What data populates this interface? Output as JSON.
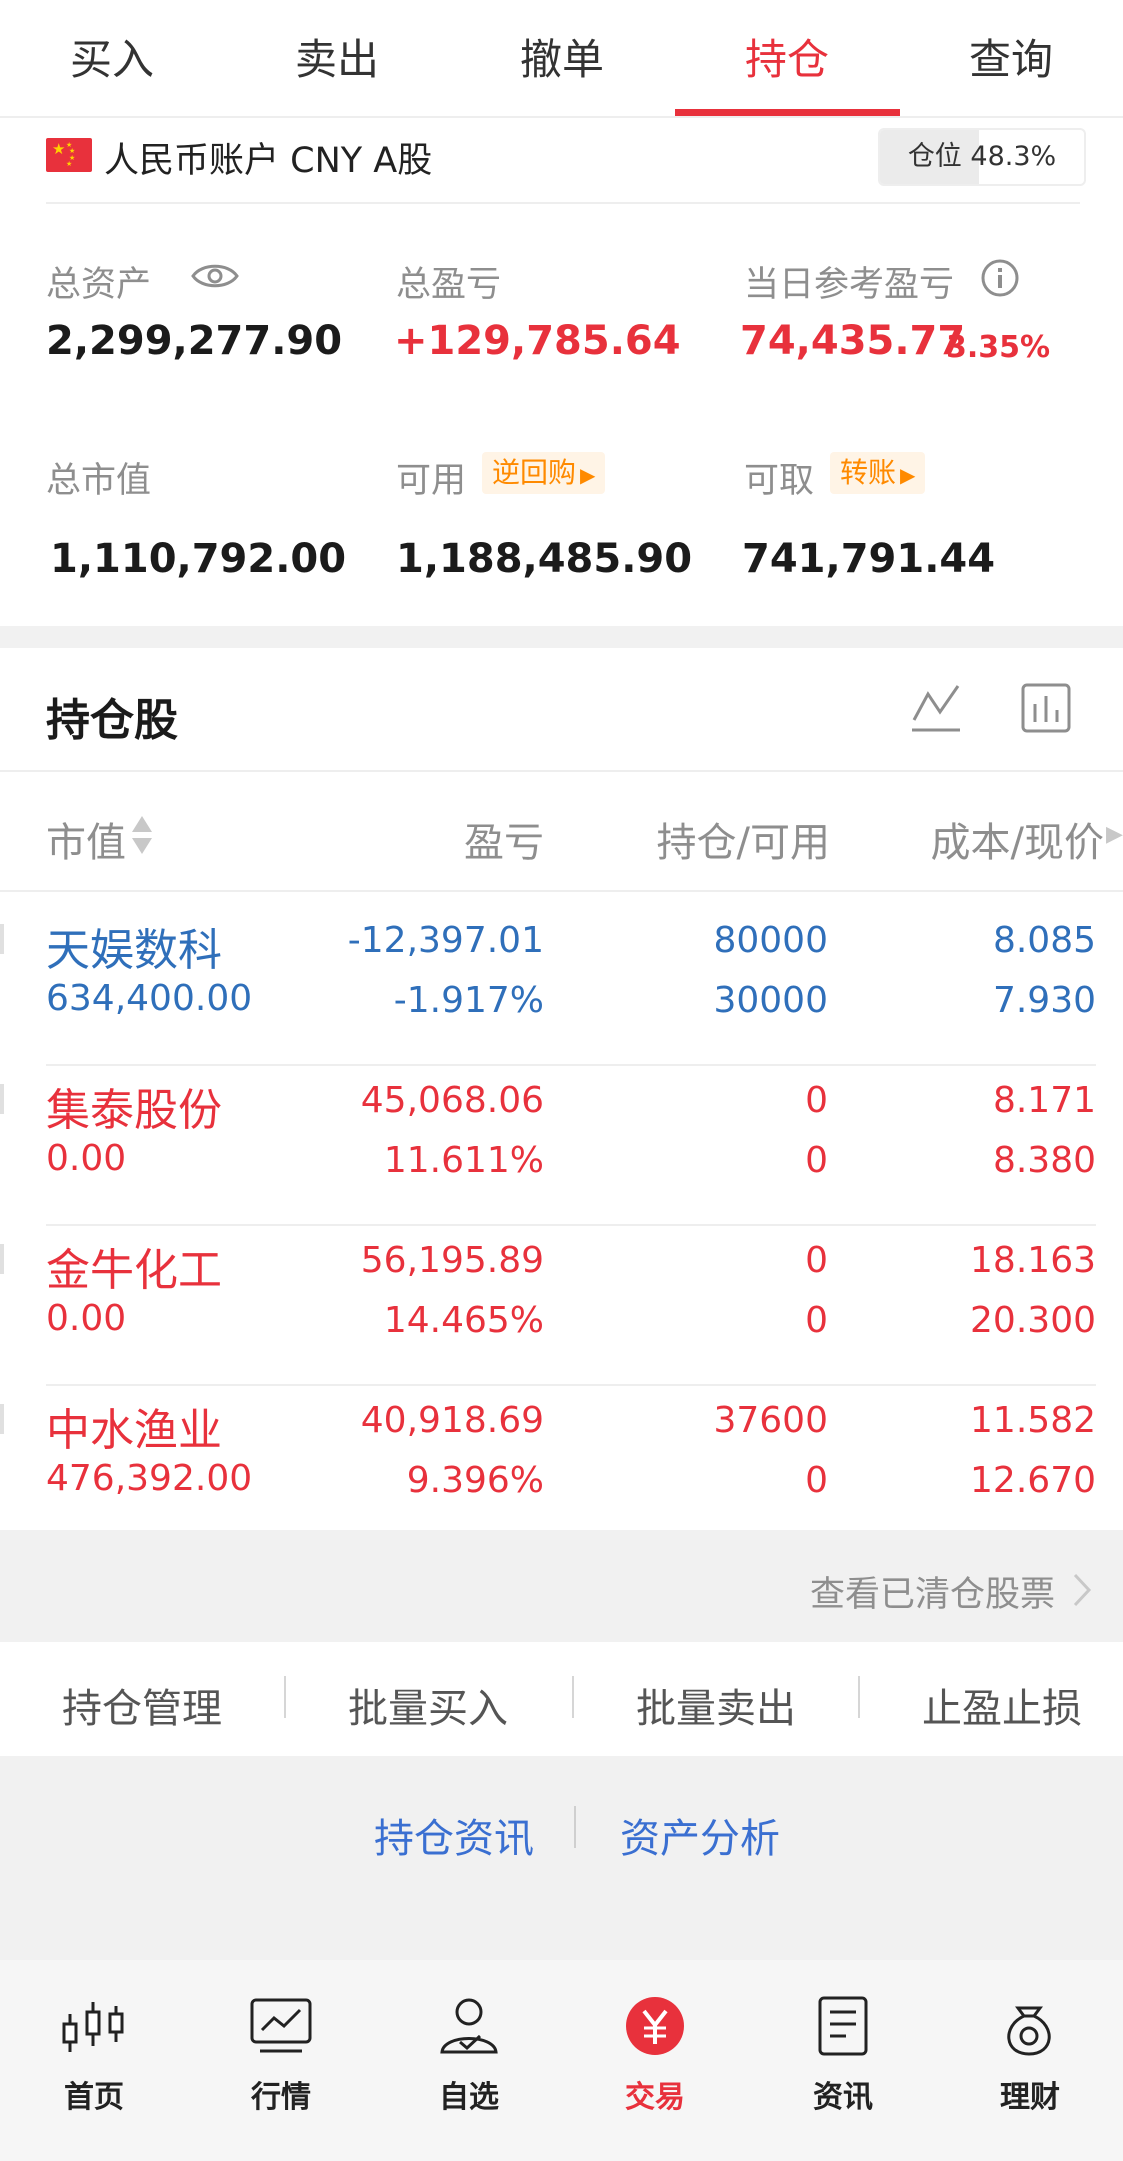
{
  "tabs": [
    "买入",
    "卖出",
    "撤单",
    "持仓",
    "查询"
  ],
  "active_tab": "持仓",
  "account": {
    "title": "人民币账户 CNY A股",
    "position_label": "仓位",
    "position_value": "48.3%",
    "position_fraction": 0.483
  },
  "summary": {
    "total_assets_label": "总资产",
    "total_assets": "2,299,277.90",
    "total_pl_label": "总盈亏",
    "total_pl": "+129,785.64",
    "day_pl_label": "当日参考盈亏",
    "day_pl": "74,435.77",
    "day_pl_pct": "3.35%",
    "market_value_label": "总市值",
    "market_value": "1,110,792.00",
    "available_label": "可用",
    "available_tag": "逆回购",
    "available": "1,188,485.90",
    "withdrawable_label": "可取",
    "withdrawable_tag": "转账",
    "withdrawable": "741,791.44"
  },
  "holdings": {
    "title": "持仓股",
    "columns": [
      "市值",
      "盈亏",
      "持仓/可用",
      "成本/现价"
    ],
    "rows": [
      {
        "name": "天娱数科",
        "market_value": "634,400.00",
        "pl": "-12,397.01",
        "pl_pct": "-1.917%",
        "position": "80000",
        "available": "30000",
        "cost": "8.085",
        "price": "7.930",
        "trend": "down"
      },
      {
        "name": "集泰股份",
        "market_value": "0.00",
        "pl": "45,068.06",
        "pl_pct": "11.611%",
        "position": "0",
        "available": "0",
        "cost": "8.171",
        "price": "8.380",
        "trend": "up"
      },
      {
        "name": "金牛化工",
        "market_value": "0.00",
        "pl": "56,195.89",
        "pl_pct": "14.465%",
        "position": "0",
        "available": "0",
        "cost": "18.163",
        "price": "20.300",
        "trend": "up"
      },
      {
        "name": "中水渔业",
        "market_value": "476,392.00",
        "pl": "40,918.69",
        "pl_pct": "9.396%",
        "position": "37600",
        "available": "0",
        "cost": "11.582",
        "price": "12.670",
        "trend": "up"
      }
    ],
    "cleared_link": "查看已清仓股票"
  },
  "actions": [
    "持仓管理",
    "批量买入",
    "批量卖出",
    "止盈止损"
  ],
  "bottom_links": [
    "持仓资讯",
    "资产分析"
  ],
  "nav": [
    {
      "label": "首页",
      "icon": "candlestick-icon"
    },
    {
      "label": "行情",
      "icon": "market-chart-icon"
    },
    {
      "label": "自选",
      "icon": "user-check-icon"
    },
    {
      "label": "交易",
      "icon": "yuan-icon"
    },
    {
      "label": "资讯",
      "icon": "document-icon"
    },
    {
      "label": "理财",
      "icon": "money-bag-icon"
    }
  ],
  "active_nav": "交易",
  "colors": {
    "accent": "#e8313c",
    "down": "#2f6fba",
    "tag": "#ff8a00",
    "link": "#3a6fd1"
  }
}
